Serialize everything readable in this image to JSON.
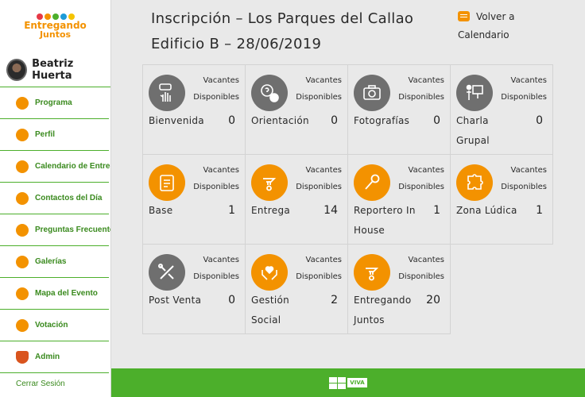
{
  "brand": {
    "logo_line1": "Entregando",
    "logo_line2": "Juntos"
  },
  "user": {
    "name": "Beatriz Huerta"
  },
  "sidebar": {
    "items": [
      {
        "label": "Programa",
        "icon": "clock-icon"
      },
      {
        "label": "Perfil",
        "icon": "person-icon"
      },
      {
        "label": "Calendario de Entregas",
        "icon": "calendar-icon"
      },
      {
        "label": "Contactos del Día",
        "icon": "contacts-icon"
      },
      {
        "label": "Preguntas Frecuentes",
        "icon": "question-icon"
      },
      {
        "label": "Galerías",
        "icon": "gallery-icon"
      },
      {
        "label": "Mapa del Evento",
        "icon": "map-icon"
      },
      {
        "label": "Votación",
        "icon": "vote-icon"
      },
      {
        "label": "Admin",
        "icon": "shield-icon"
      }
    ],
    "cut_item": "Cerrar Sesión"
  },
  "header": {
    "title": "Inscripción – Los Parques del Callao Edificio B – 28/06/2019",
    "back_label": "Volver a Calendario"
  },
  "activity_header": {
    "line1": "Vacantes",
    "line2": "Disponibles"
  },
  "activities": [
    {
      "name": "Bienvenida",
      "count": "0",
      "icon": "hand-hola-icon",
      "color": "grey"
    },
    {
      "name": "Orientación",
      "count": "0",
      "icon": "orientation-icon",
      "color": "grey"
    },
    {
      "name": "Fotografías",
      "count": "0",
      "icon": "camera-icon",
      "color": "grey"
    },
    {
      "name": "Charla Grupal",
      "count": "0",
      "icon": "presentation-icon",
      "color": "grey"
    },
    {
      "name": "Base",
      "count": "1",
      "icon": "clipboard-icon",
      "color": "orange"
    },
    {
      "name": "Entrega",
      "count": "14",
      "icon": "giving-hand-icon",
      "color": "orange"
    },
    {
      "name": "Reportero In House",
      "count": "1",
      "icon": "microphone-icon",
      "color": "orange"
    },
    {
      "name": "Zona Lúdica",
      "count": "1",
      "icon": "puzzle-icon",
      "color": "orange"
    },
    {
      "name": "Post Venta",
      "count": "0",
      "icon": "tools-icon",
      "color": "grey"
    },
    {
      "name": "Gestión Social",
      "count": "2",
      "icon": "heart-hands-icon",
      "color": "orange"
    },
    {
      "name": "Entregando Juntos",
      "count": "20",
      "icon": "giving-hand-icon",
      "color": "orange"
    }
  ],
  "footer": {
    "tag": "VIVA"
  },
  "colors": {
    "accent": "#f39200",
    "green": "#4caf2b",
    "grey_icon": "#6f6f6f"
  }
}
